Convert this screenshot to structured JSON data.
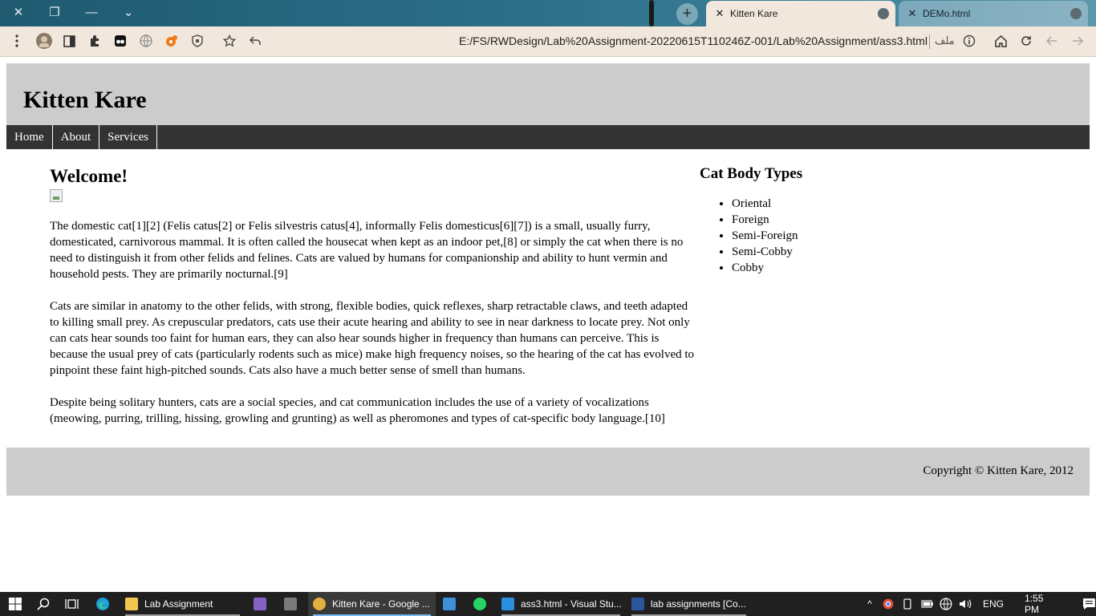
{
  "browser": {
    "tabs": [
      {
        "title": "Kitten Kare",
        "active": true
      },
      {
        "title": "DEMo.html",
        "active": false
      }
    ],
    "window_controls": {
      "close": "✕",
      "restore": "❐",
      "minimize": "—",
      "tab_search": "⌄"
    },
    "url": "E:/FS/RWDesign/Lab%20Assignment-20220615T110246Z-001/Lab%20Assignment/ass3.html",
    "url_scheme_label": "ملف",
    "icons": [
      "menu-dots-icon",
      "profile-icon",
      "sidebar-icon",
      "extensions-icon",
      "extension-icon",
      "translate-icon",
      "extension-orange-icon",
      "shield-icon",
      "star-icon",
      "share-icon",
      "info-icon",
      "home-icon",
      "reload-icon",
      "back-icon",
      "forward-icon"
    ]
  },
  "page": {
    "header_title": "Kitten Kare",
    "nav": [
      "Home",
      "About",
      "Services"
    ],
    "main": {
      "heading": "Welcome!",
      "paragraphs": [
        "The domestic cat[1][2] (Felis catus[2] or Felis silvestris catus[4], informally Felis domesticus[6][7]) is a small, usually furry, domesticated, carnivorous mammal. It is often called the housecat when kept as an indoor pet,[8] or simply the cat when there is no need to distinguish it from other felids and felines. Cats are valued by humans for companionship and ability to hunt vermin and household pests. They are primarily nocturnal.[9]",
        "Cats are similar in anatomy to the other felids, with strong, flexible bodies, quick reflexes, sharp retractable claws, and teeth adapted to killing small prey. As crepuscular predators, cats use their acute hearing and ability to see in near darkness to locate prey. Not only can cats hear sounds too faint for human ears, they can also hear sounds higher in frequency than humans can perceive. This is because the usual prey of cats (particularly rodents such as mice) make high frequency noises, so the hearing of the cat has evolved to pinpoint these faint high-pitched sounds. Cats also have a much better sense of smell than humans.",
        "Despite being solitary hunters, cats are a social species, and cat communication includes the use of a variety of vocalizations (meowing, purring, trilling, hissing, growling and grunting) as well as pheromones and types of cat-specific body language.[10]"
      ]
    },
    "sidebar": {
      "heading": "Cat Body Types",
      "items": [
        "Oriental",
        "Foreign",
        "Semi-Foreign",
        "Semi-Cobby",
        "Cobby"
      ]
    },
    "footer": "Copyright © Kitten Kare, 2012"
  },
  "taskbar": {
    "apps": [
      {
        "label": "Lab Assignment",
        "active": false,
        "color": "#f3c74d"
      },
      {
        "label": "",
        "active": false,
        "color": "#8661c5"
      },
      {
        "label": "",
        "active": false,
        "color": "#7a7a7a"
      },
      {
        "label": "Kitten Kare - Google ...",
        "active": true,
        "color": "#e2b13c"
      },
      {
        "label": "",
        "active": false,
        "color": "#3c8fd8"
      },
      {
        "label": "",
        "active": false,
        "color": "#25d366"
      },
      {
        "label": "ass3.html - Visual Stu...",
        "active": false,
        "color": "#2b8fe0"
      },
      {
        "label": "lab assignments [Co...",
        "active": false,
        "color": "#2b579a"
      }
    ],
    "language": "ENG",
    "time": "1:55 PM"
  },
  "colors": {
    "header_bg": "#cccccc",
    "nav_bg": "#333333",
    "tab_active_bg": "#f1e7dc",
    "taskbar_bg": "#202020"
  }
}
